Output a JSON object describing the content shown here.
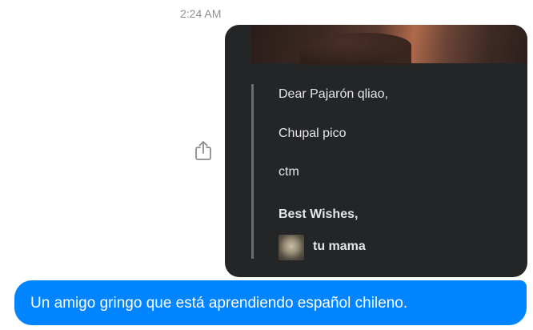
{
  "timestamp": "2:24 AM",
  "share": {
    "icon": "share-icon"
  },
  "email_card": {
    "greeting": "Dear Pajarón qliao,",
    "body_line_1": "Chupal pico",
    "body_line_2": "ctm",
    "closing": "Best Wishes,",
    "signature_name": "tu mama"
  },
  "message": {
    "text": "Un amigo gringo que está aprendiendo español chileno.",
    "color": "#0084ff"
  },
  "colors": {
    "card_bg": "#242526",
    "card_text": "#e4e6eb",
    "timestamp": "#8a8d91"
  }
}
